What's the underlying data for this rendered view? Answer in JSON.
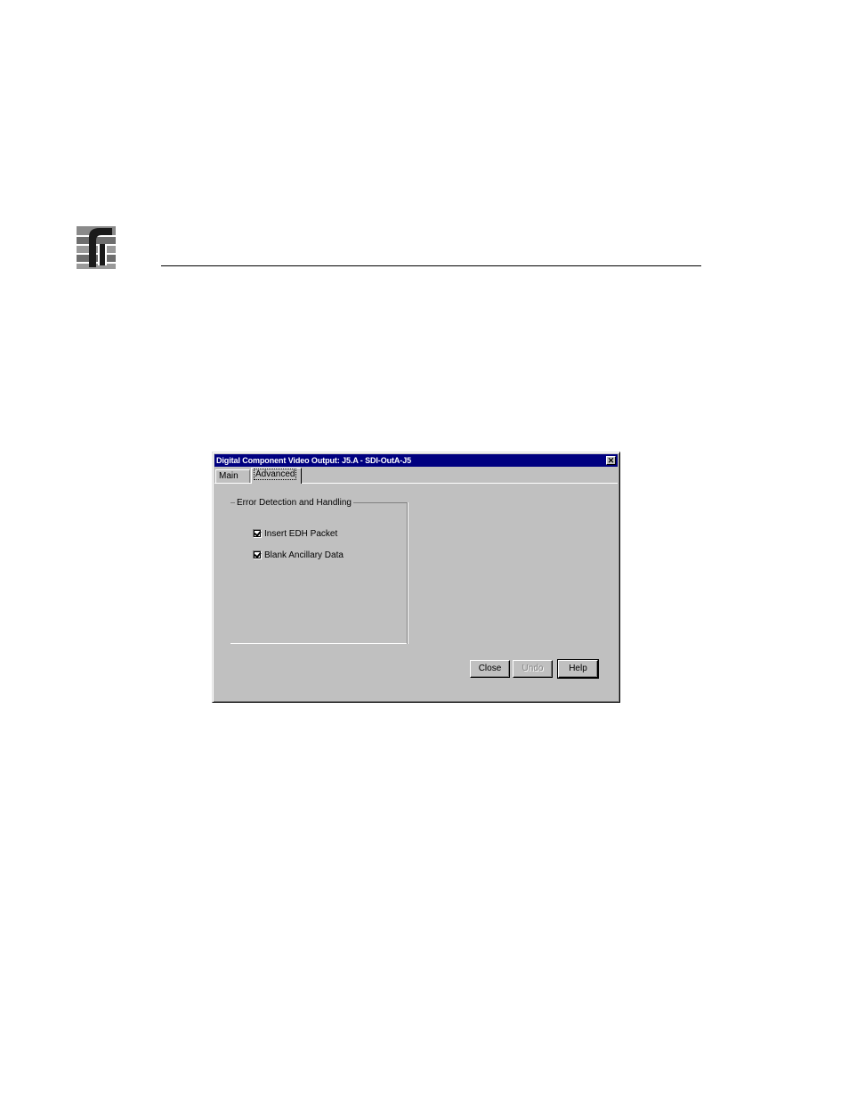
{
  "dialog": {
    "title": "Digital Component Video Output: J5.A - SDI-OutA-J5",
    "close_glyph": "✕",
    "tabs": [
      {
        "label": "Main"
      },
      {
        "label": "Advanced"
      }
    ],
    "group": {
      "label": "Error Detection and Handling",
      "options": [
        {
          "label": "Insert EDH Packet",
          "checked": true
        },
        {
          "label": "Blank Ancillary Data",
          "checked": true
        }
      ]
    },
    "buttons": {
      "close": "Close",
      "undo": "Undo",
      "help": "Help"
    }
  }
}
